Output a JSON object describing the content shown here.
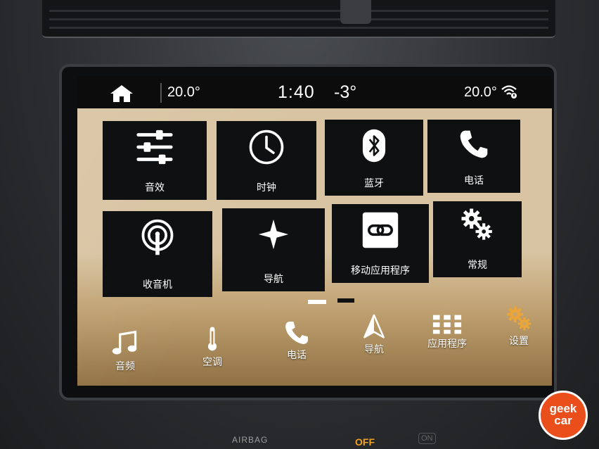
{
  "status_bar": {
    "inside_temp_left": "20.0°",
    "time": "1:40",
    "outside_temp": "-3°",
    "inside_temp_right": "20.0°",
    "home_icon": "home-icon",
    "wifi_icon": "wifi-icon"
  },
  "tiles": [
    {
      "label": "音效",
      "icon": "equalizer-icon"
    },
    {
      "label": "时钟",
      "icon": "clock-icon"
    },
    {
      "label": "蓝牙",
      "icon": "bluetooth-icon"
    },
    {
      "label": "电话",
      "icon": "phone-icon"
    },
    {
      "label": "收音机",
      "icon": "radio-icon"
    },
    {
      "label": "导航",
      "icon": "navigation-star-icon"
    },
    {
      "label": "移动应用程序",
      "icon": "mobile-apps-link-icon"
    },
    {
      "label": "常规",
      "icon": "gears-icon"
    }
  ],
  "pager": {
    "pages": 2,
    "active": 1
  },
  "dock": [
    {
      "label": "音频",
      "icon": "music-note-icon"
    },
    {
      "label": "空调",
      "icon": "thermometer-icon"
    },
    {
      "label": "电话",
      "icon": "phone-icon"
    },
    {
      "label": "导航",
      "icon": "navigation-arrow-icon"
    },
    {
      "label": "应用程序",
      "icon": "apps-grid-icon"
    },
    {
      "label": "设置",
      "icon": "settings-gear-icon"
    }
  ],
  "dashboard": {
    "airbag_text": "AIRBAG",
    "off_text": "OFF",
    "on_text": "ON"
  },
  "watermark": {
    "line1": "geek",
    "line2": "car"
  },
  "colors": {
    "tile_bg": "#0f1011",
    "screen_bg": "#d8c4a2",
    "settings_accent": "#e9a53a",
    "watermark_bg": "#e94e1b"
  }
}
